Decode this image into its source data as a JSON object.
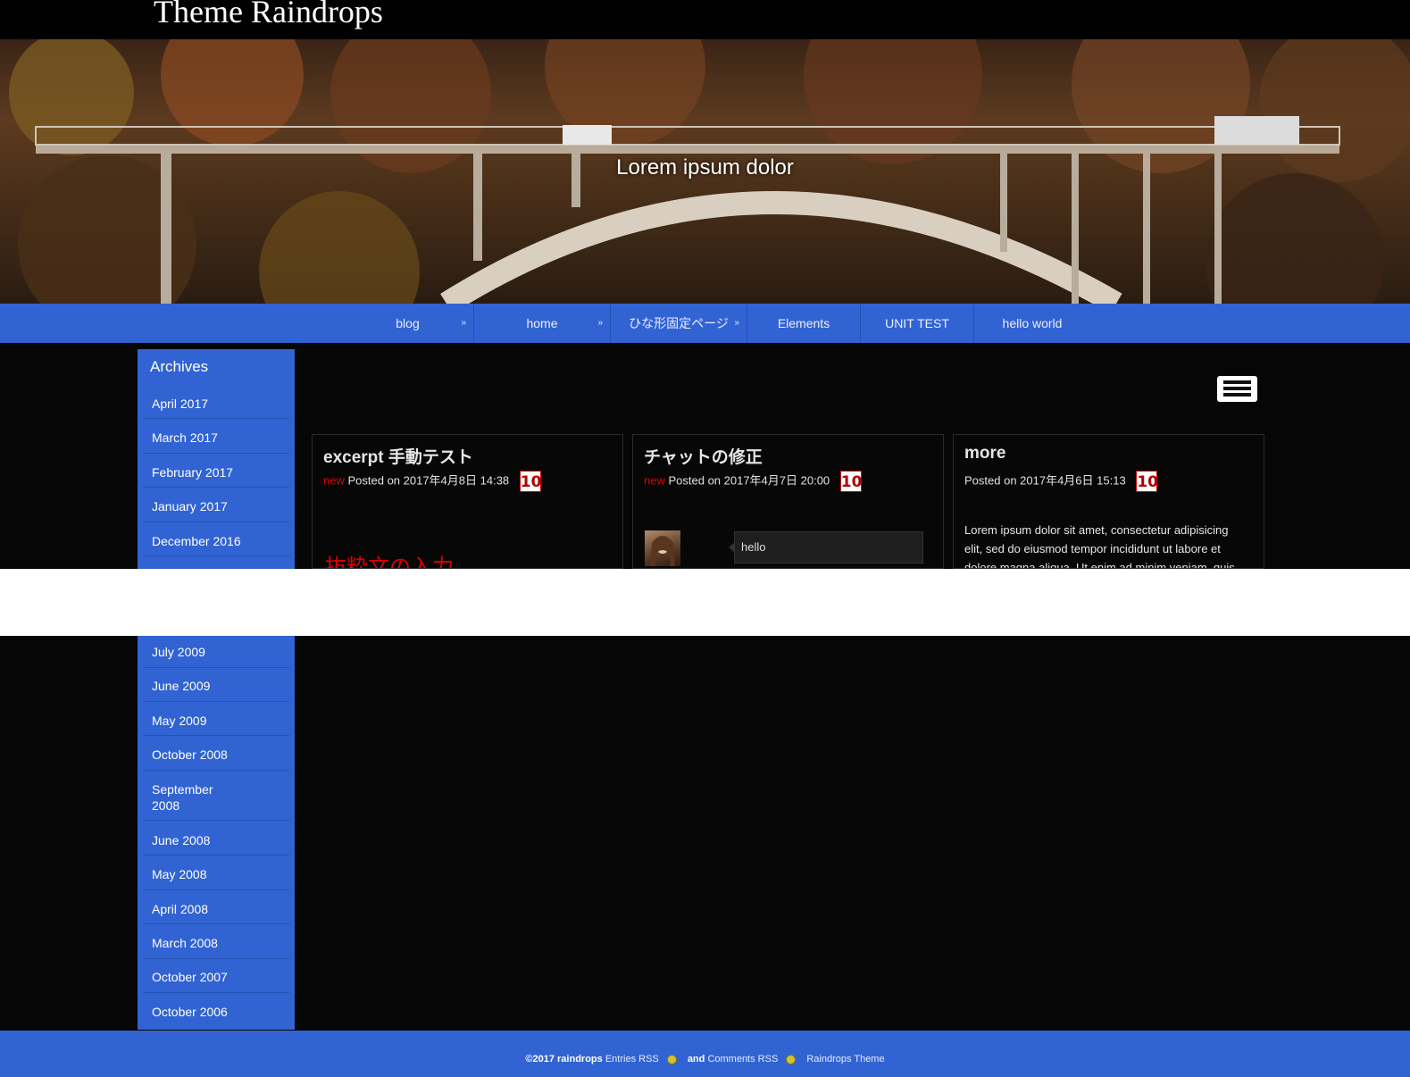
{
  "site": {
    "title": "Theme Raindrops"
  },
  "hero": {
    "caption": "Lorem ipsum dolor"
  },
  "nav": {
    "items": [
      {
        "label": "blog",
        "has_submenu": true
      },
      {
        "label": "home",
        "has_submenu": true
      },
      {
        "label": "ひな形固定ページ",
        "has_submenu": true
      },
      {
        "label": "Elements",
        "has_submenu": false
      },
      {
        "label": "UNIT TEST",
        "has_submenu": false
      },
      {
        "label": "hello world",
        "has_submenu": false
      }
    ],
    "submenu_arrow": "»"
  },
  "sidebar": {
    "title": "Archives",
    "items_top": [
      "April 2017",
      "March 2017",
      "February 2017",
      "January 2017",
      "December 2016"
    ],
    "items_bottom": [
      "July 2009",
      "June 2009",
      "May 2009",
      "October 2008",
      "September 2008",
      "June 2008",
      "May 2008",
      "April 2008",
      "March 2008",
      "October 2007",
      "October 2006"
    ]
  },
  "posts": [
    {
      "title": "excerpt 手動テスト",
      "new_label": "new",
      "posted": "Posted on 2017年4月8日 14:38",
      "comment_count": "10",
      "excerpt_heading": "抜粋文の入力"
    },
    {
      "title": "チャットの修正",
      "new_label": "new",
      "posted": "Posted on 2017年4月7日 20:00",
      "comment_count": "10",
      "chat_message": "hello"
    },
    {
      "title": "more",
      "new_label": "",
      "posted": "Posted on 2017年4月6日 15:13",
      "comment_count": "10",
      "body": "Lorem ipsum dolor sit amet, consectetur adipisicing elit, sed do eiusmod tempor incididunt ut labore et dolore magna aliqua. Ut enim ad minim veniam, quis"
    }
  ],
  "footer": {
    "copyright": "©2017 raindrops",
    "entries_rss": "Entries RSS",
    "and": "and",
    "comments_rss": "Comments RSS",
    "theme_link": "Raindrops Theme"
  },
  "colors": {
    "accent": "#3163d3",
    "background": "#060606",
    "new_label": "#e00000"
  }
}
